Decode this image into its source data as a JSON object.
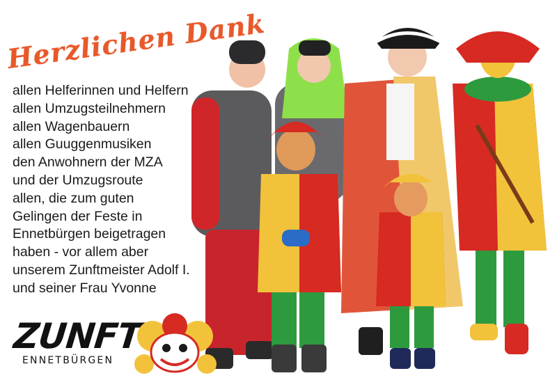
{
  "title": "Herzlichen Dank",
  "thanks_lines": [
    "allen Helferinnen und Helfern",
    "allen Umzugsteilnehmern",
    "allen Wagenbauern",
    "allen Guuggenmusiken",
    "den Anwohnern der MZA",
    "und der Umzugsroute",
    "allen, die zum guten",
    "Gelingen der Feste in",
    "Ennetbürgen beigetragen",
    "haben - vor allem aber",
    "unserem Zunftmeister Adolf I.",
    "und seiner Frau Yvonne"
  ],
  "logo": {
    "wordmark": "ZUNFT",
    "sub": "ENNETBÜRGEN"
  },
  "colors": {
    "title": "#e8592a",
    "text": "#1a1a1a",
    "jester_red": "#d62a22",
    "jester_yellow": "#f2c23a",
    "jester_green": "#2e9a3e"
  },
  "icons": {
    "photo": "group-photo-carnival-costumes",
    "logo_mascot": "jester-face-icon"
  }
}
